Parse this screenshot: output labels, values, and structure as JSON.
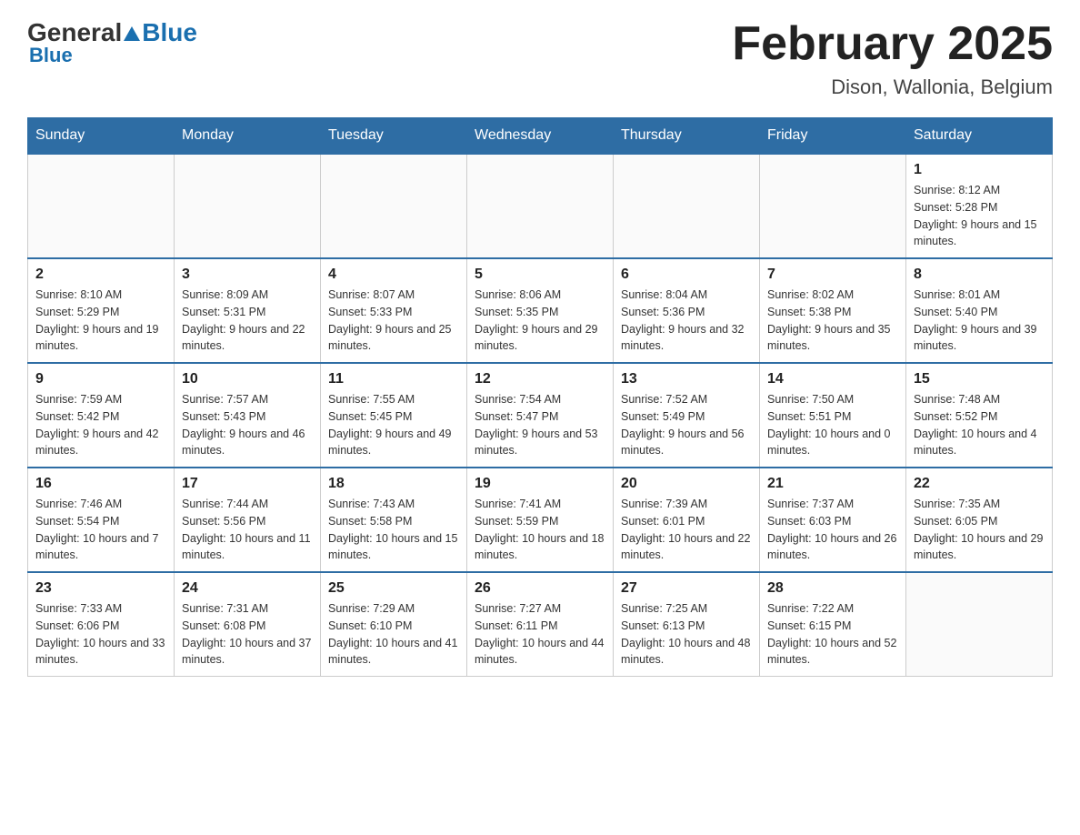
{
  "header": {
    "logo_general": "General",
    "logo_blue": "Blue",
    "title": "February 2025",
    "subtitle": "Dison, Wallonia, Belgium"
  },
  "days_of_week": [
    "Sunday",
    "Monday",
    "Tuesday",
    "Wednesday",
    "Thursday",
    "Friday",
    "Saturday"
  ],
  "weeks": [
    [
      {
        "day": "",
        "info": ""
      },
      {
        "day": "",
        "info": ""
      },
      {
        "day": "",
        "info": ""
      },
      {
        "day": "",
        "info": ""
      },
      {
        "day": "",
        "info": ""
      },
      {
        "day": "",
        "info": ""
      },
      {
        "day": "1",
        "info": "Sunrise: 8:12 AM\nSunset: 5:28 PM\nDaylight: 9 hours and 15 minutes."
      }
    ],
    [
      {
        "day": "2",
        "info": "Sunrise: 8:10 AM\nSunset: 5:29 PM\nDaylight: 9 hours and 19 minutes."
      },
      {
        "day": "3",
        "info": "Sunrise: 8:09 AM\nSunset: 5:31 PM\nDaylight: 9 hours and 22 minutes."
      },
      {
        "day": "4",
        "info": "Sunrise: 8:07 AM\nSunset: 5:33 PM\nDaylight: 9 hours and 25 minutes."
      },
      {
        "day": "5",
        "info": "Sunrise: 8:06 AM\nSunset: 5:35 PM\nDaylight: 9 hours and 29 minutes."
      },
      {
        "day": "6",
        "info": "Sunrise: 8:04 AM\nSunset: 5:36 PM\nDaylight: 9 hours and 32 minutes."
      },
      {
        "day": "7",
        "info": "Sunrise: 8:02 AM\nSunset: 5:38 PM\nDaylight: 9 hours and 35 minutes."
      },
      {
        "day": "8",
        "info": "Sunrise: 8:01 AM\nSunset: 5:40 PM\nDaylight: 9 hours and 39 minutes."
      }
    ],
    [
      {
        "day": "9",
        "info": "Sunrise: 7:59 AM\nSunset: 5:42 PM\nDaylight: 9 hours and 42 minutes."
      },
      {
        "day": "10",
        "info": "Sunrise: 7:57 AM\nSunset: 5:43 PM\nDaylight: 9 hours and 46 minutes."
      },
      {
        "day": "11",
        "info": "Sunrise: 7:55 AM\nSunset: 5:45 PM\nDaylight: 9 hours and 49 minutes."
      },
      {
        "day": "12",
        "info": "Sunrise: 7:54 AM\nSunset: 5:47 PM\nDaylight: 9 hours and 53 minutes."
      },
      {
        "day": "13",
        "info": "Sunrise: 7:52 AM\nSunset: 5:49 PM\nDaylight: 9 hours and 56 minutes."
      },
      {
        "day": "14",
        "info": "Sunrise: 7:50 AM\nSunset: 5:51 PM\nDaylight: 10 hours and 0 minutes."
      },
      {
        "day": "15",
        "info": "Sunrise: 7:48 AM\nSunset: 5:52 PM\nDaylight: 10 hours and 4 minutes."
      }
    ],
    [
      {
        "day": "16",
        "info": "Sunrise: 7:46 AM\nSunset: 5:54 PM\nDaylight: 10 hours and 7 minutes."
      },
      {
        "day": "17",
        "info": "Sunrise: 7:44 AM\nSunset: 5:56 PM\nDaylight: 10 hours and 11 minutes."
      },
      {
        "day": "18",
        "info": "Sunrise: 7:43 AM\nSunset: 5:58 PM\nDaylight: 10 hours and 15 minutes."
      },
      {
        "day": "19",
        "info": "Sunrise: 7:41 AM\nSunset: 5:59 PM\nDaylight: 10 hours and 18 minutes."
      },
      {
        "day": "20",
        "info": "Sunrise: 7:39 AM\nSunset: 6:01 PM\nDaylight: 10 hours and 22 minutes."
      },
      {
        "day": "21",
        "info": "Sunrise: 7:37 AM\nSunset: 6:03 PM\nDaylight: 10 hours and 26 minutes."
      },
      {
        "day": "22",
        "info": "Sunrise: 7:35 AM\nSunset: 6:05 PM\nDaylight: 10 hours and 29 minutes."
      }
    ],
    [
      {
        "day": "23",
        "info": "Sunrise: 7:33 AM\nSunset: 6:06 PM\nDaylight: 10 hours and 33 minutes."
      },
      {
        "day": "24",
        "info": "Sunrise: 7:31 AM\nSunset: 6:08 PM\nDaylight: 10 hours and 37 minutes."
      },
      {
        "day": "25",
        "info": "Sunrise: 7:29 AM\nSunset: 6:10 PM\nDaylight: 10 hours and 41 minutes."
      },
      {
        "day": "26",
        "info": "Sunrise: 7:27 AM\nSunset: 6:11 PM\nDaylight: 10 hours and 44 minutes."
      },
      {
        "day": "27",
        "info": "Sunrise: 7:25 AM\nSunset: 6:13 PM\nDaylight: 10 hours and 48 minutes."
      },
      {
        "day": "28",
        "info": "Sunrise: 7:22 AM\nSunset: 6:15 PM\nDaylight: 10 hours and 52 minutes."
      },
      {
        "day": "",
        "info": ""
      }
    ]
  ]
}
